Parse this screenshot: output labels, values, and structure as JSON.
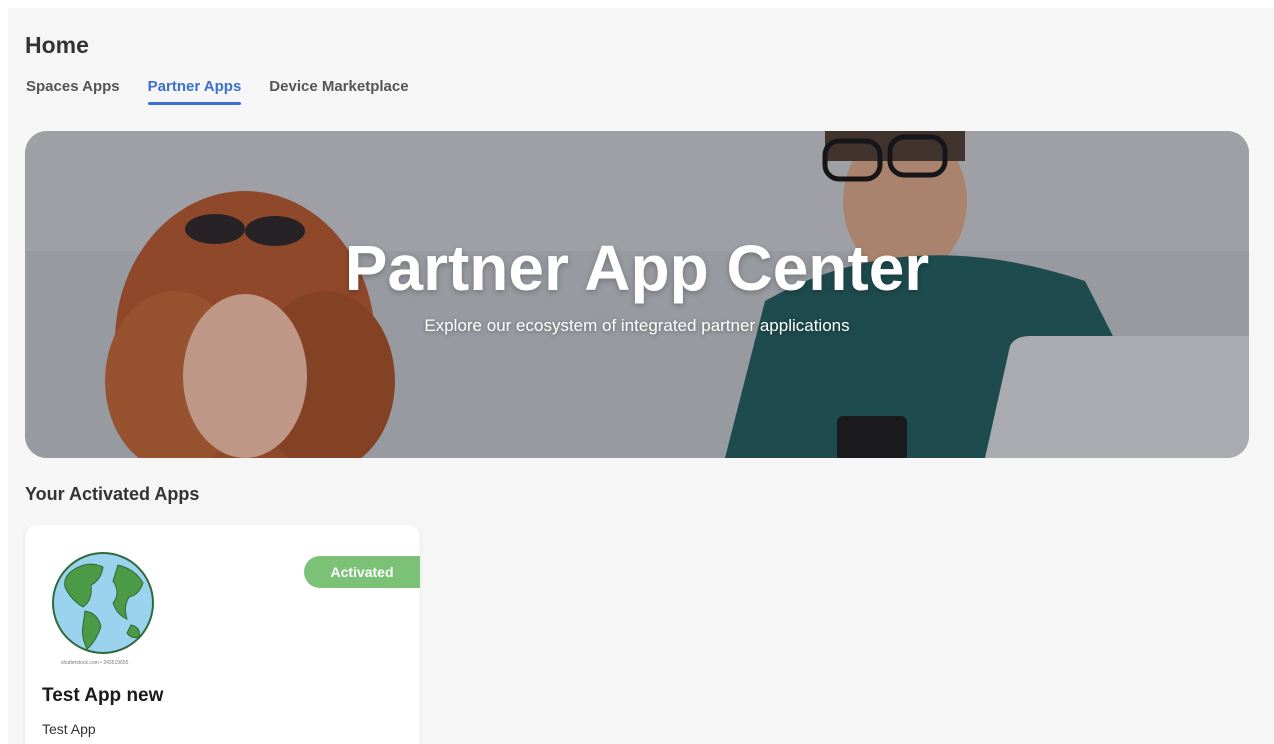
{
  "header": {
    "title": "Home"
  },
  "tabs": [
    {
      "label": "Spaces Apps",
      "active": false
    },
    {
      "label": "Partner Apps",
      "active": true
    },
    {
      "label": "Device Marketplace",
      "active": false
    }
  ],
  "hero": {
    "title": "Partner App Center",
    "subtitle": "Explore our ecosystem of integrated partner applications"
  },
  "activated_apps": {
    "section_title": "Your Activated Apps",
    "cards": [
      {
        "name": "Test App new",
        "description": "Test App",
        "status": "Activated",
        "logo_icon": "globe-icon",
        "logo_credit": "shutterstock.com • 243519655"
      }
    ]
  },
  "colors": {
    "accent": "#3b6fd1",
    "status_activated": "#7cc276",
    "page_background": "#f6f6f6"
  }
}
